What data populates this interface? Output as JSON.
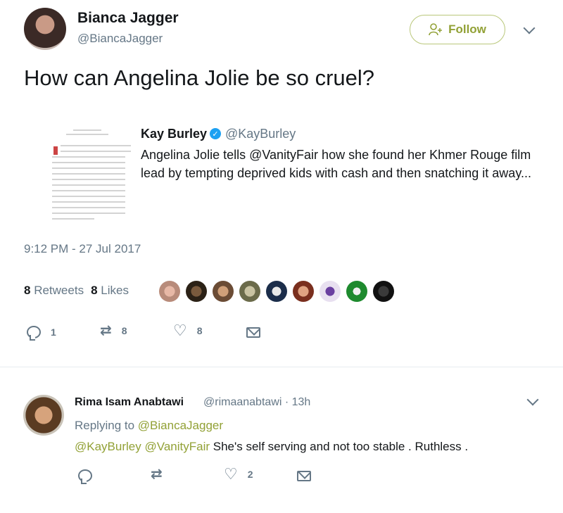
{
  "tweet": {
    "author_name": "Bianca Jagger",
    "author_handle": "@BiancaJagger",
    "follow_label": "Follow",
    "text": "How can Angelina Jolie be so cruel?",
    "timestamp": "9:12 PM - 27 Jul 2017",
    "retweets_count": "8",
    "retweets_label": "Retweets",
    "likes_count": "8",
    "likes_label": "Likes",
    "actions": {
      "reply_count": "1",
      "retweet_count": "8",
      "like_count": "8"
    }
  },
  "quote": {
    "author_name": "Kay Burley",
    "author_handle": "@KayBurley",
    "text": "Angelina Jolie tells @VanityFair how she found her Khmer Rouge film lead by tempting deprived kids with cash and then snatching it away..."
  },
  "reply": {
    "author_name": "Rima Isam Anabtawi",
    "author_handle": "@rimaanabtawi · 13h",
    "replying_prefix": "Replying to",
    "replying_to": "@BiancaJagger",
    "mention1": "@KayBurley",
    "mention2": "@VanityFair",
    "text": "She's self serving and not too stable . Ruthless .",
    "actions": {
      "like_count": "2"
    }
  },
  "icons": {
    "follow": "person-add-icon",
    "dropdown": "chevron-down-icon",
    "reply": "reply-icon",
    "retweet": "retweet-icon",
    "like": "heart-icon",
    "dm": "mail-icon",
    "verified": "verified-badge-icon"
  },
  "colors": {
    "accent": "#92a136",
    "secondary_text": "#657786",
    "verified": "#1da1f2"
  }
}
